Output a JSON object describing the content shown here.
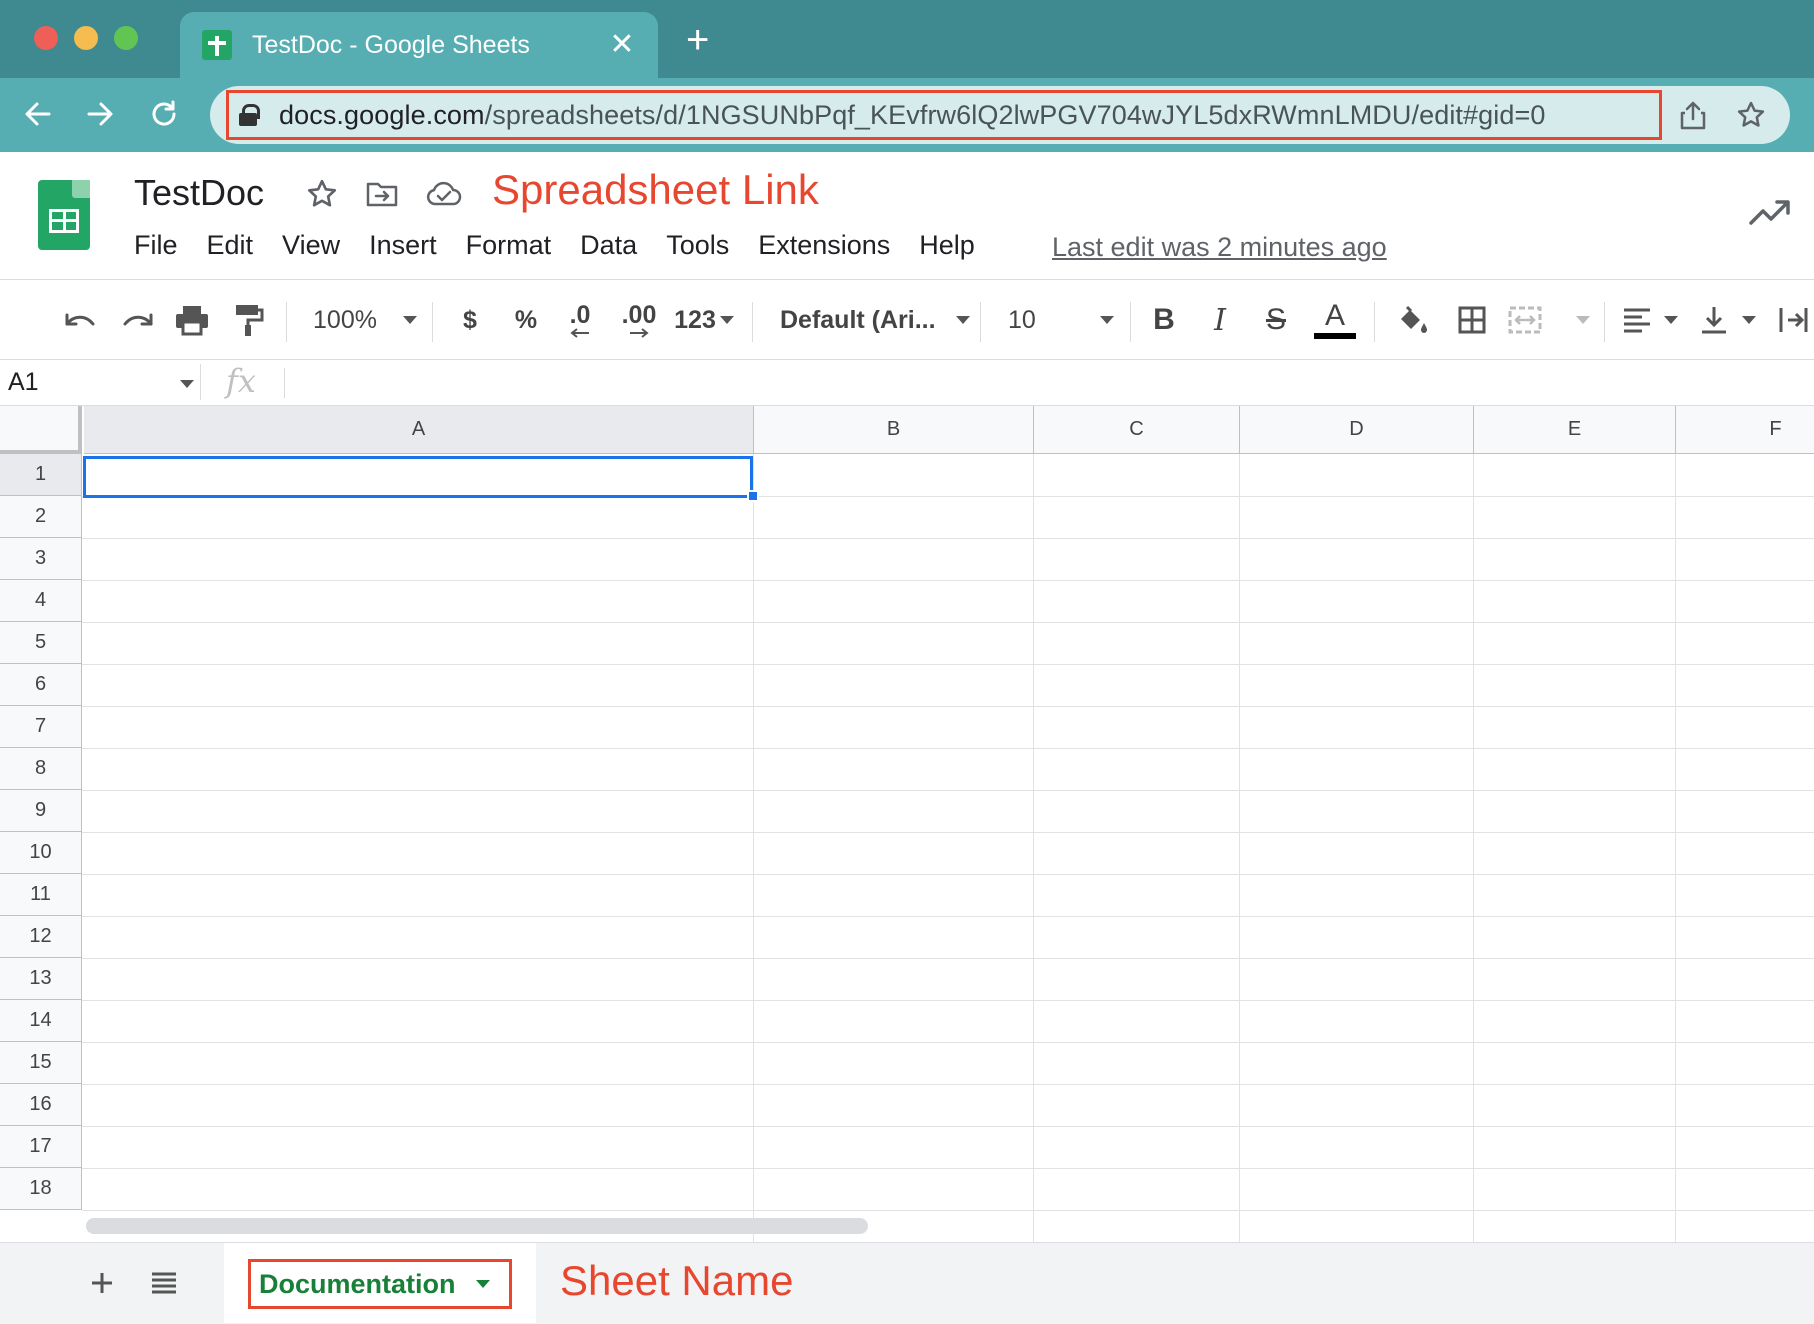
{
  "browser": {
    "tab_title": "TestDoc - Google Sheets",
    "tab_close": "✕",
    "new_tab": "+",
    "url_host": "docs.google.com",
    "url_path": "/spreadsheets/d/1NGSUNbPqf_KEvfrw6lQ2lwPGV704wJYL5dxRWmnLMDU/edit#gid=0"
  },
  "header": {
    "doc_title": "TestDoc",
    "annotation_link": "Spreadsheet Link",
    "menu": [
      "File",
      "Edit",
      "View",
      "Insert",
      "Format",
      "Data",
      "Tools",
      "Extensions",
      "Help"
    ],
    "last_edit": "Last edit was 2 minutes ago"
  },
  "toolbar": {
    "zoom": "100%",
    "currency": "$",
    "percent": "%",
    "decrease_decimal": ".0",
    "increase_decimal": ".00",
    "more_formats": "123",
    "font": "Default (Ari...",
    "font_size": "10",
    "bold": "B",
    "italic": "I",
    "strike": "S",
    "text_color": "A"
  },
  "formula_bar": {
    "name_box": "A1",
    "fx": "fx",
    "value": ""
  },
  "grid": {
    "columns": [
      "A",
      "B",
      "C",
      "D",
      "E",
      "F"
    ],
    "rows": [
      "1",
      "2",
      "3",
      "4",
      "5",
      "6",
      "7",
      "8",
      "9",
      "10",
      "11",
      "12",
      "13",
      "14",
      "15",
      "16",
      "17",
      "18"
    ],
    "selected_cell": "A1"
  },
  "sheets": {
    "active_sheet": "Documentation",
    "annotation_sheet": "Sheet Name"
  },
  "colors": {
    "chrome_teal": "#3f8990",
    "annotation_red": "#e8472f",
    "sheet_green": "#188038",
    "selection_blue": "#1a73e8"
  }
}
